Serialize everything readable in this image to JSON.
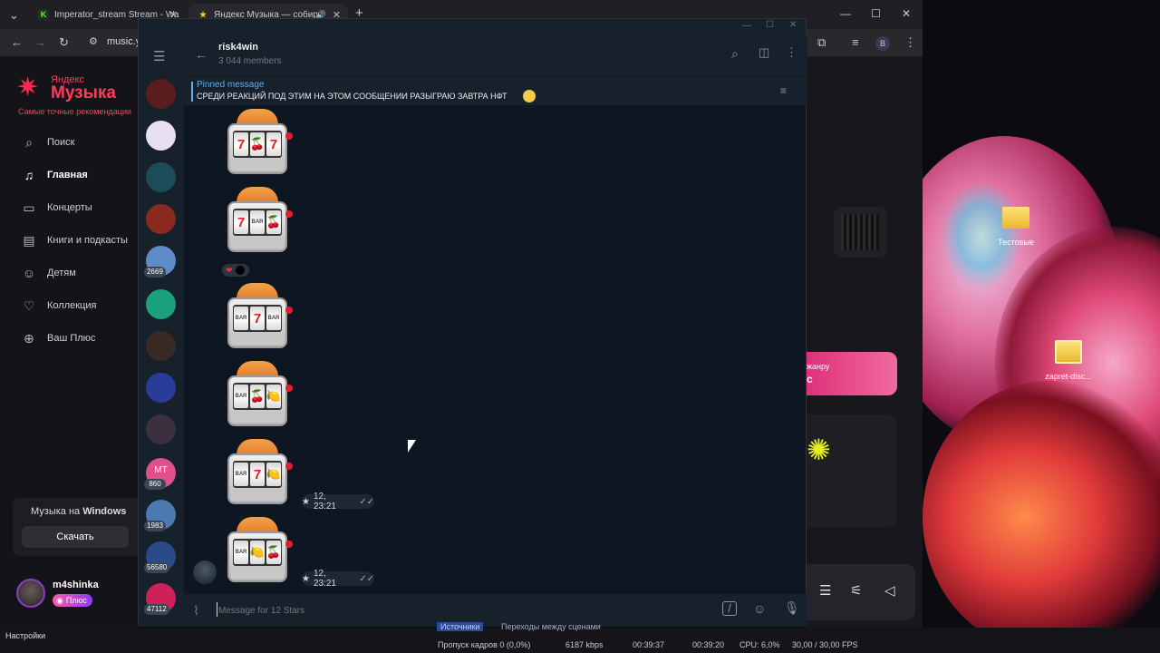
{
  "browser": {
    "tabs": [
      {
        "title": "Imperator_stream Stream - Wa",
        "icon": "K"
      },
      {
        "title": "Яндекс Музыка — собира",
        "icon": "★"
      }
    ],
    "url": "music.y"
  },
  "yandex": {
    "logo_small": "Яндекс",
    "logo_big": "Музыка",
    "tagline": "Самые точные рекомендации",
    "nav": [
      {
        "label": "Поиск",
        "icon": "search-icon"
      },
      {
        "label": "Главная",
        "icon": "music-note-icon"
      },
      {
        "label": "Концерты",
        "icon": "ticket-icon"
      },
      {
        "label": "Книги и подкасты",
        "icon": "book-icon"
      },
      {
        "label": "Детям",
        "icon": "kids-icon"
      },
      {
        "label": "Коллекция",
        "icon": "heart-icon"
      },
      {
        "label": "Ваш Плюс",
        "icon": "plus-icon"
      }
    ],
    "promo_text_a": "Музыка на",
    "promo_text_b": "Windows",
    "download_label": "Скачать",
    "username": "m4shinka",
    "plus_label": "Плюс",
    "right_promo_line1": "жанру",
    "right_promo_line2": "с",
    "settings_label": "Настройки"
  },
  "desktop": {
    "icons": [
      {
        "label": "Тестовые"
      },
      {
        "label": "zapret-disc..."
      }
    ]
  },
  "telegram": {
    "chat_title": "risk4win",
    "members": "3 044 members",
    "pinned_label": "Pinned message",
    "pinned_text": "СРЕДИ РЕАКЦИЙ ПОД ЭТИМ НА ЭТОМ СООБЩЕНИИ РАЗЫГРАЮ ЗАВТРА НФТ",
    "folders": [
      {
        "color": "#5a1d1d",
        "badge": ""
      },
      {
        "color": "#e8e0f0",
        "badge": ""
      },
      {
        "color": "#1c4b5a",
        "badge": ""
      },
      {
        "color": "#8a2a1e",
        "badge": ""
      },
      {
        "color": "#5e8cc8",
        "badge": "2669"
      },
      {
        "color": "#1aa07a",
        "badge": ""
      },
      {
        "color": "#3a2a24",
        "badge": ""
      },
      {
        "color": "#2a3c9a",
        "badge": ""
      },
      {
        "color": "#3a3040",
        "badge": ""
      },
      {
        "color": "#e0508a",
        "badge": "860",
        "initials": "MT"
      },
      {
        "color": "#4a7ab0",
        "badge": "1983"
      },
      {
        "color": "#2a4a8a",
        "badge": "56580"
      },
      {
        "color": "#d0205a",
        "badge": "47112"
      }
    ],
    "slots": [
      {
        "reels": [
          "7",
          "🍒",
          "7"
        ]
      },
      {
        "reels": [
          "7",
          "BAR",
          "🍒"
        ]
      },
      {
        "reels": [
          "BAR",
          "7",
          "BAR"
        ]
      },
      {
        "reels": [
          "BAR",
          "🍒",
          "🍋"
        ]
      },
      {
        "reels": [
          "BAR",
          "7",
          "🍋"
        ]
      },
      {
        "reels": [
          "BAR",
          "🍋",
          "🍒"
        ]
      }
    ],
    "time_stamps": [
      "12, 23:21",
      "12, 23:21"
    ],
    "reaction": "❤",
    "input_placeholder": "Message for 12 Stars"
  },
  "taskbar": {
    "items": [
      "Источники",
      "Переходы между сценами",
      "Пропуск кадров 0 (0,0%)",
      "6187 kbps",
      "00:39:37",
      "00:39:20",
      "CPU: 6,0%",
      "30,00 / 30,00 FPS"
    ]
  }
}
